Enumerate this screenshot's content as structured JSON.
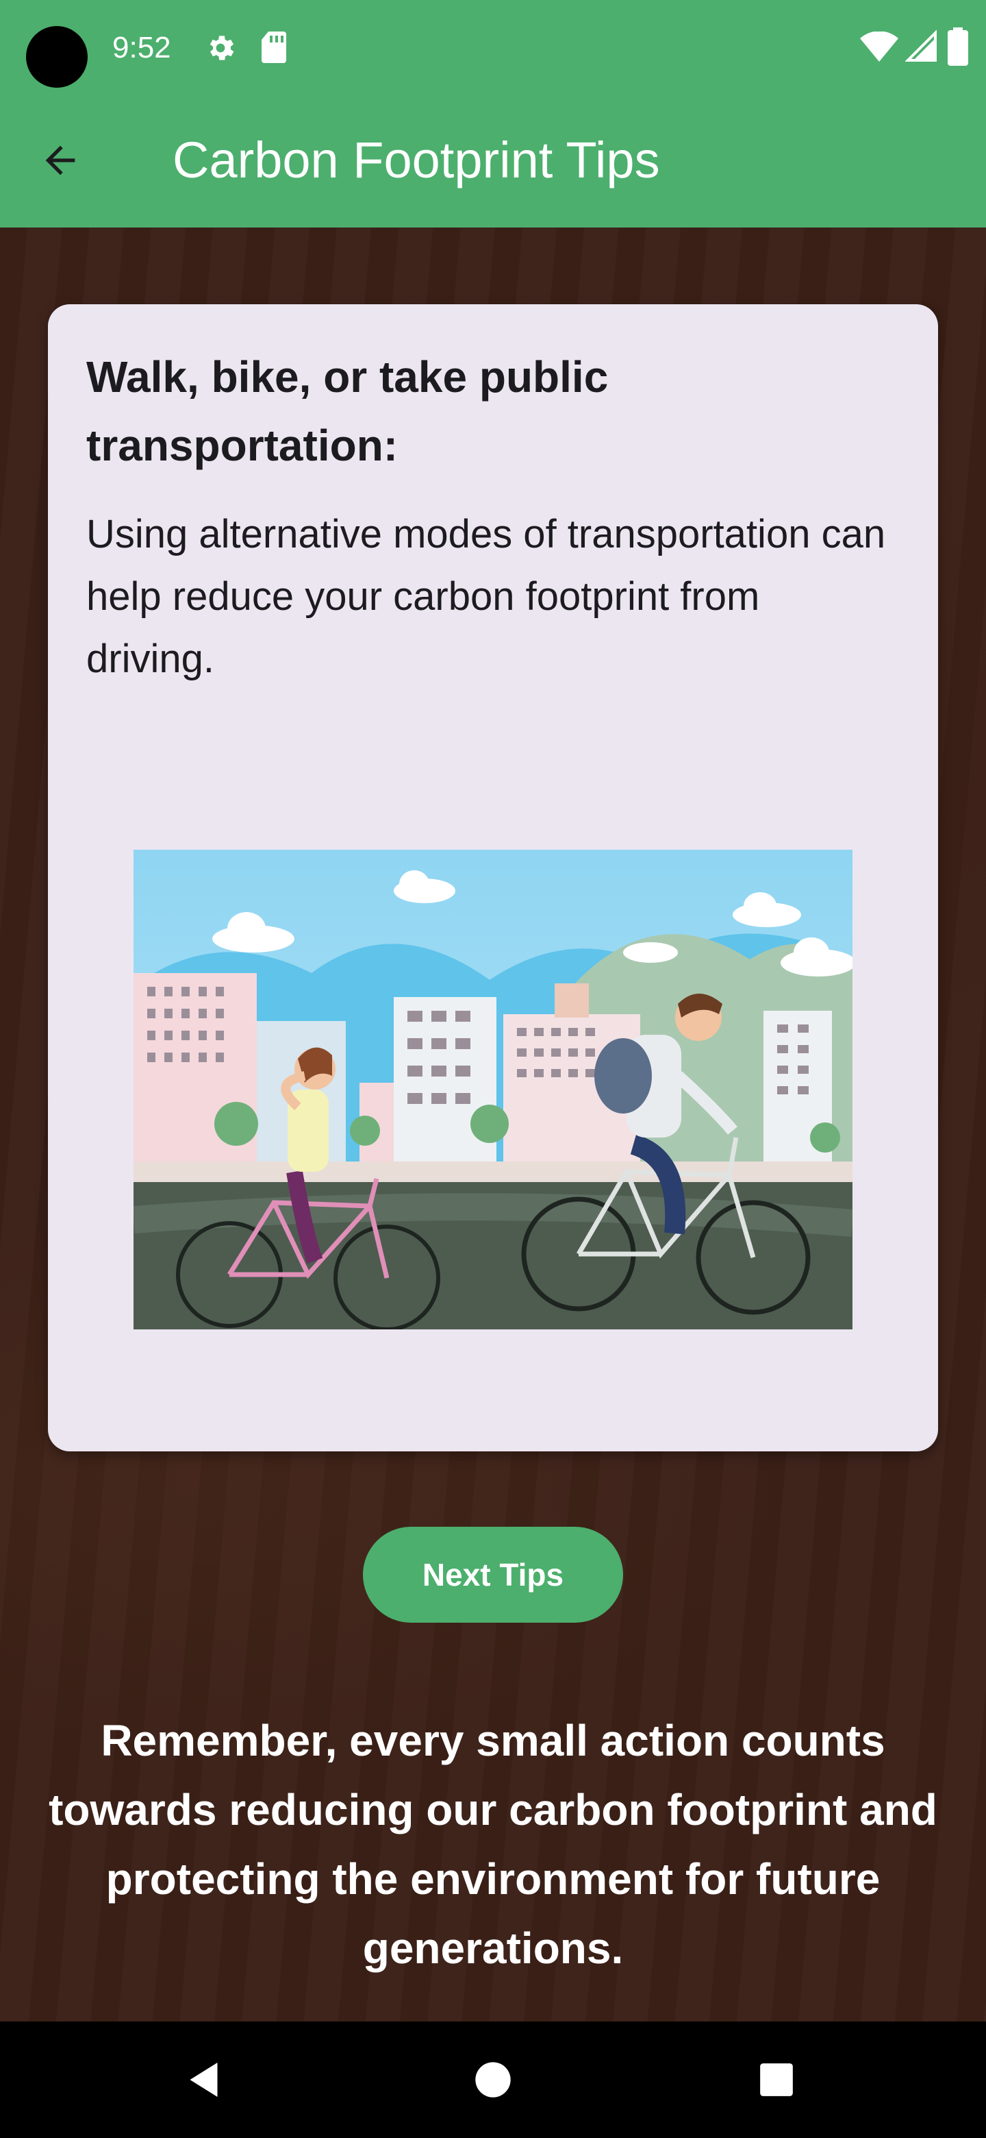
{
  "status_bar": {
    "time": "9:52",
    "icons": [
      "settings-gear-icon",
      "sd-card-icon",
      "wifi-icon",
      "cell-signal-icon",
      "battery-icon"
    ]
  },
  "app_bar": {
    "back_icon": "arrow-back-icon",
    "title": "Carbon Footprint Tips"
  },
  "tip": {
    "heading": "Walk, bike, or take public transportation:",
    "body": "Using alternative modes of transportation can help reduce your carbon footprint from driving.",
    "illustration": "two-cyclists-city-illustration"
  },
  "next_button": {
    "label": "Next Tips"
  },
  "footer": {
    "message": "Remember, every small action counts towards reducing our carbon footprint and protecting the environment for future generations."
  },
  "nav_bar": {
    "icons": [
      "nav-back-icon",
      "nav-home-icon",
      "nav-recents-icon"
    ]
  },
  "colors": {
    "primary_green": "#4caf6d",
    "background_brown": "#3b2017",
    "card_background": "#ece6f1",
    "text_dark": "#1c1b1f"
  }
}
